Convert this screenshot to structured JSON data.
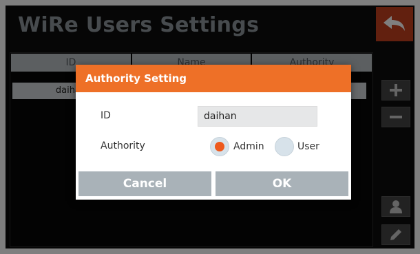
{
  "header": {
    "title": "WiRe Users Settings",
    "back_icon": "back-arrow-icon"
  },
  "table": {
    "columns": [
      "ID",
      "Name",
      "Authority"
    ],
    "rows": [
      {
        "id": "daihan"
      }
    ]
  },
  "sidebar": {
    "buttons": [
      {
        "name": "add-user-button",
        "icon": "plus-icon"
      },
      {
        "name": "remove-user-button",
        "icon": "minus-icon"
      },
      {
        "name": "user-info-button",
        "icon": "user-icon"
      },
      {
        "name": "edit-user-button",
        "icon": "pencil-icon"
      }
    ]
  },
  "dialog": {
    "title": "Authority Setting",
    "id_label": "ID",
    "id_value": "daihan",
    "authority_label": "Authority",
    "options": [
      "Admin",
      "User"
    ],
    "selected_option": "Admin",
    "cancel_label": "Cancel",
    "ok_label": "OK"
  },
  "colors": {
    "accent": "#ee7027",
    "back_button": "#c4411e",
    "screen_bg": "#0c0c0c",
    "title_text": "#8f969c",
    "dialog_button": "#a9b2b8"
  }
}
